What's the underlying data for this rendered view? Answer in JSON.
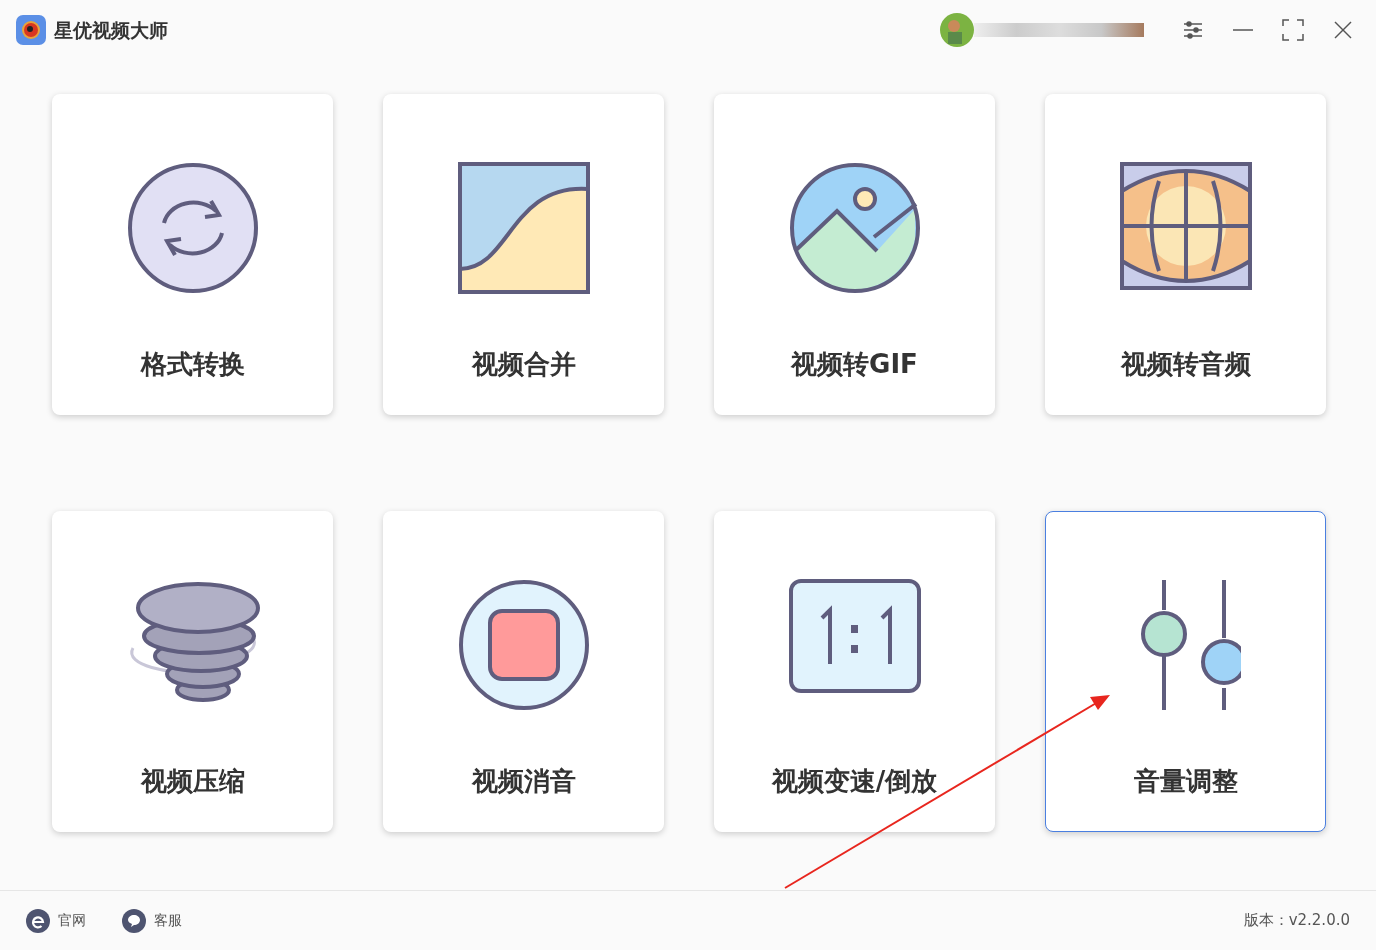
{
  "window": {
    "title": "星优视频大师"
  },
  "tiles": [
    {
      "label": "格式转换",
      "selected": false
    },
    {
      "label": "视频合并",
      "selected": false
    },
    {
      "label": "视频转GIF",
      "selected": false
    },
    {
      "label": "视频转音频",
      "selected": false
    },
    {
      "label": "视频压缩",
      "selected": false
    },
    {
      "label": "视频消音",
      "selected": false
    },
    {
      "label": "视频变速/倒放",
      "selected": false
    },
    {
      "label": "音量调整",
      "selected": true
    }
  ],
  "footer": {
    "links": [
      "官网",
      "客服"
    ],
    "version": "版本：v2.2.0.0"
  }
}
